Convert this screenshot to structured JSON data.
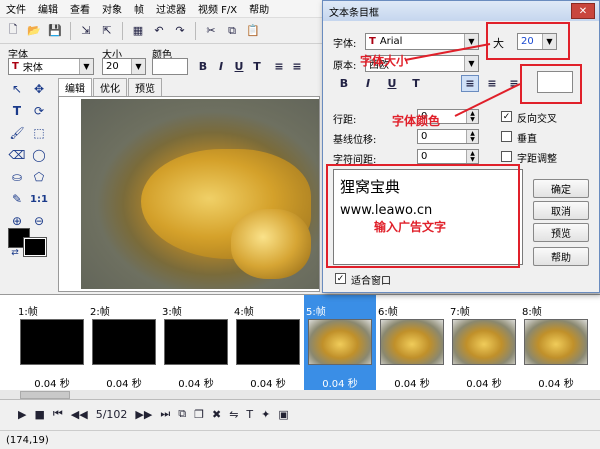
{
  "menu": [
    "文件",
    "编辑",
    "查看",
    "对象",
    "帧",
    "过滤器",
    "视频 F/X",
    "帮助"
  ],
  "font_row": {
    "font_label": "字体",
    "font_value": "宋体",
    "size_label": "大小",
    "size_value": "20",
    "color_label": "颜色"
  },
  "tabs": [
    "编辑",
    "优化",
    "预览"
  ],
  "frames": [
    {
      "label": "1:帧",
      "duration": "0.04 秒"
    },
    {
      "label": "2:帧",
      "duration": "0.04 秒"
    },
    {
      "label": "3:帧",
      "duration": "0.04 秒"
    },
    {
      "label": "4:帧",
      "duration": "0.04 秒"
    },
    {
      "label": "5:帧",
      "duration": "0.04 秒"
    },
    {
      "label": "6:帧",
      "duration": "0.04 秒"
    },
    {
      "label": "7:帧",
      "duration": "0.04 秒"
    },
    {
      "label": "8:帧",
      "duration": "0.04 秒"
    }
  ],
  "playback": {
    "counter": "5/102"
  },
  "status": {
    "coords": "(174,19)"
  },
  "dialog": {
    "title": "文本条目框",
    "close": "✕",
    "font_label": "字体:",
    "font_value": "Arial",
    "size_prefix": "大",
    "size_value": "20",
    "source_label": "原本:",
    "source_value": "西欧",
    "line_spacing_label": "行距:",
    "line_spacing_value": "0",
    "baseline_label": "基线位移:",
    "baseline_value": "0",
    "char_spacing_label": "字符间距:",
    "char_spacing_value": "0",
    "reverse_label": "反向交叉",
    "vertical_label": "垂直",
    "kerning_label": "字距调整",
    "text_line1": "狸窝宝典",
    "text_line2": "www.leawo.cn",
    "ok_label": "确定",
    "cancel_label": "取消",
    "preview_label": "预览",
    "help_label": "帮助",
    "fit_label": "适合窗口"
  },
  "annotations": {
    "font_size": "字体大小",
    "font_color": "字体颜色",
    "input_text": "输入广告文字"
  },
  "colors": {
    "annotation": "#e0202a",
    "selected_frame": "#3a8ee6",
    "title_bar": "#c5d6ee"
  }
}
